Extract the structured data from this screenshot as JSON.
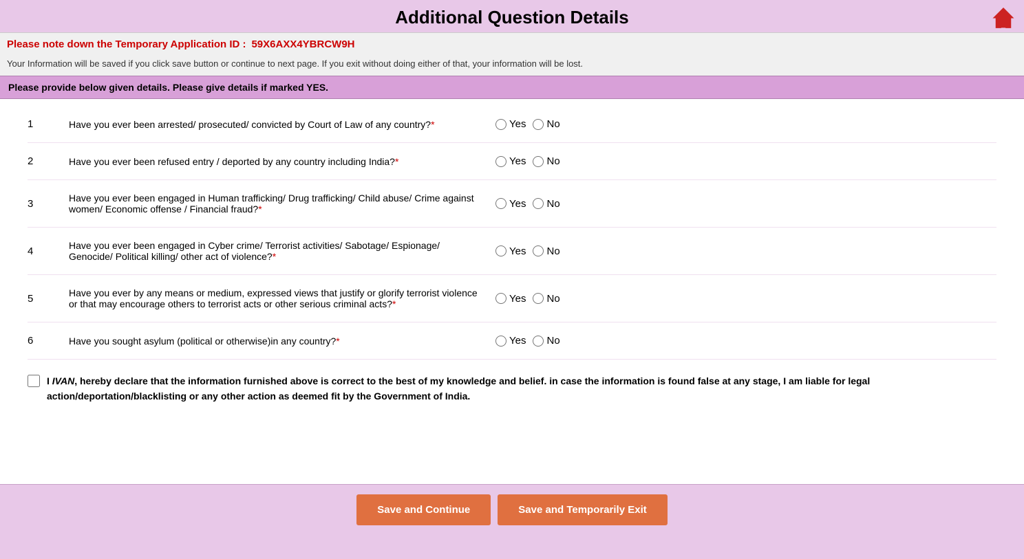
{
  "page": {
    "title": "Additional Question Details",
    "temp_id_label": "Please note down the Temporary Application ID :",
    "temp_id_value": "59X6AXX4YBRCW9H",
    "info_text": "Your Information will be saved if you click save button or continue to next page. If you exit without doing either of that, your information will be lost.",
    "instruction": "Please provide below given details. Please give details if marked YES.",
    "declaration": {
      "name": "IVAN",
      "text_before": "I ",
      "text_after": ", hereby declare that the information furnished above is correct to the best of my knowledge and belief. in case the information is found false at any stage, I am liable for legal action/deportation/blacklisting or any other action as deemed fit by the Government of India."
    },
    "buttons": {
      "save_continue": "Save and Continue",
      "save_exit": "Save and Temporarily Exit"
    },
    "radio_yes": "Yes",
    "radio_no": "No",
    "questions": [
      {
        "number": "1",
        "text": "Have you ever been arrested/ prosecuted/ convicted by Court of Law of any country?",
        "required": true
      },
      {
        "number": "2",
        "text": "Have you ever been refused entry / deported by any country including India?",
        "required": true
      },
      {
        "number": "3",
        "text": "Have you ever been engaged in Human trafficking/ Drug trafficking/ Child abuse/ Crime against women/ Economic offense / Financial fraud?",
        "required": true
      },
      {
        "number": "4",
        "text": "Have you ever been engaged in Cyber crime/ Terrorist activities/ Sabotage/ Espionage/ Genocide/ Political killing/ other act of violence?",
        "required": true
      },
      {
        "number": "5",
        "text": "Have you ever by any means or medium, expressed views that justify or glorify terrorist violence or that may encourage others to terrorist acts or other serious criminal acts?",
        "required": true
      },
      {
        "number": "6",
        "text": "Have you sought asylum (political or otherwise)in any country?",
        "required": true
      }
    ]
  }
}
